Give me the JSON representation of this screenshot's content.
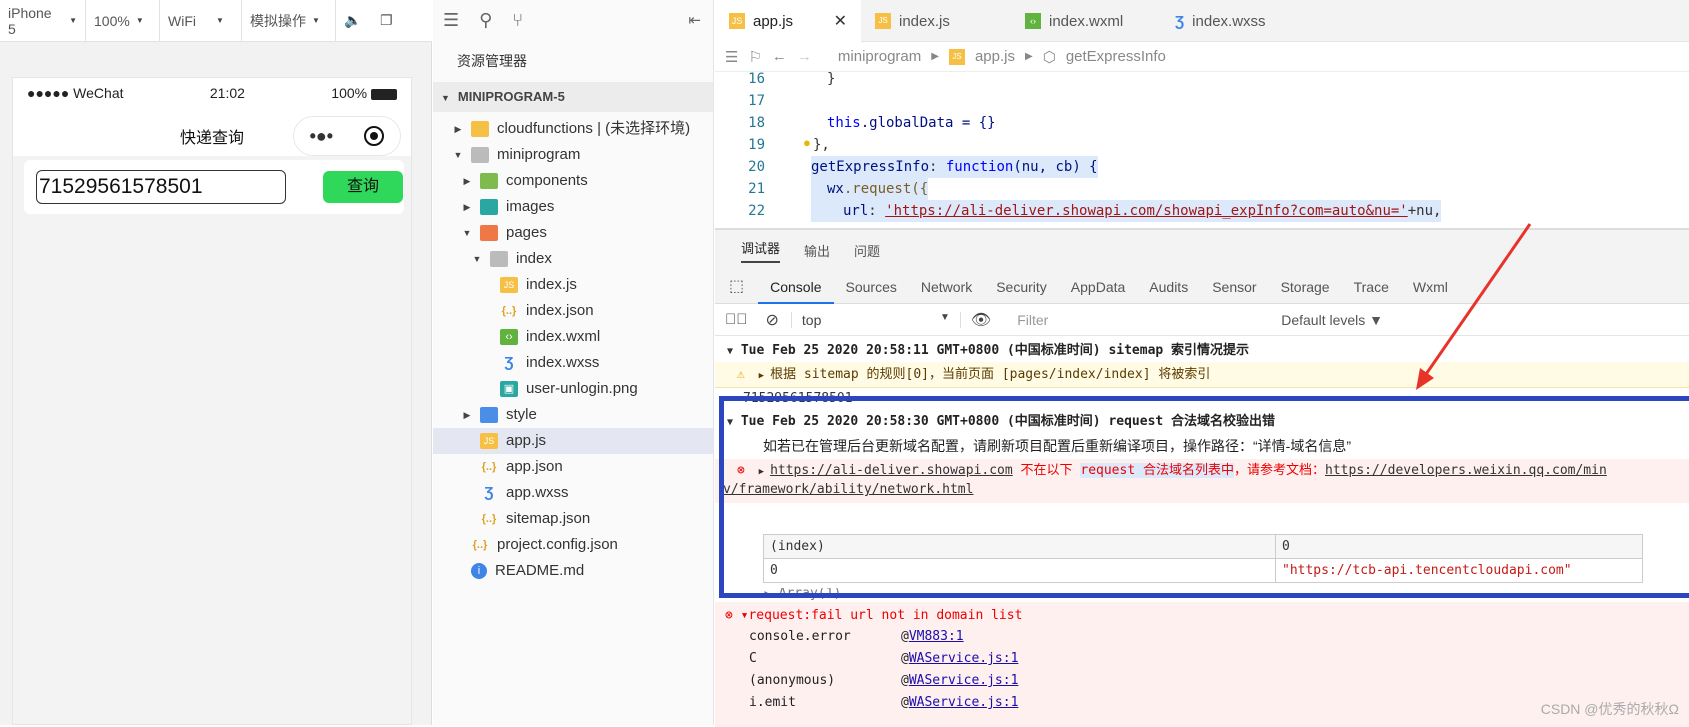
{
  "simulator": {
    "toolbar": {
      "device": "iPhone 5",
      "zoom": "100%",
      "network": "WiFi",
      "operation": "模拟操作"
    },
    "status": {
      "carrier": "●●●●● WeChat",
      "time": "21:02",
      "battery": "100%"
    },
    "page_title": "快递查询",
    "query_input_value": "71529561578501",
    "query_button": "查询"
  },
  "explorer": {
    "title": "资源管理器",
    "project": "MINIPROGRAM-5",
    "items": [
      {
        "label": "cloudfunctions | (未选择环境)",
        "icon": "folder-icon",
        "level": 1
      },
      {
        "label": "miniprogram",
        "icon": "folder-icon",
        "level": 1
      },
      {
        "label": "components",
        "icon": "folder-icon",
        "level": 2
      },
      {
        "label": "images",
        "icon": "folder-icon",
        "level": 2
      },
      {
        "label": "pages",
        "icon": "folder-icon",
        "level": 2
      },
      {
        "label": "index",
        "icon": "folder-icon",
        "level": 3
      },
      {
        "label": "index.js",
        "icon": "js-file-icon",
        "level": 4
      },
      {
        "label": "index.json",
        "icon": "json-file-icon",
        "level": 4
      },
      {
        "label": "index.wxml",
        "icon": "wxml-file-icon",
        "level": 4
      },
      {
        "label": "index.wxss",
        "icon": "wxss-file-icon",
        "level": 4
      },
      {
        "label": "user-unlogin.png",
        "icon": "image-file-icon",
        "level": 4
      },
      {
        "label": "style",
        "icon": "folder-icon",
        "level": 2
      },
      {
        "label": "app.js",
        "icon": "js-file-icon",
        "level": 2
      },
      {
        "label": "app.json",
        "icon": "json-file-icon",
        "level": 2
      },
      {
        "label": "app.wxss",
        "icon": "wxss-file-icon",
        "level": 2
      },
      {
        "label": "sitemap.json",
        "icon": "json-file-icon",
        "level": 2
      },
      {
        "label": "project.config.json",
        "icon": "json-file-icon",
        "level": 1
      },
      {
        "label": "README.md",
        "icon": "info-icon",
        "level": 1
      }
    ]
  },
  "editor": {
    "tabs": [
      "app.js",
      "index.js",
      "index.wxml",
      "index.wxss"
    ],
    "breadcrumb": [
      "miniprogram",
      "app.js",
      "getExpressInfo"
    ],
    "code": {
      "l16_num": "16",
      "l16": "}",
      "l17_num": "17",
      "l18_num": "18",
      "l18a": "this",
      "l18b": ".globalData = {}",
      "l19_num": "19",
      "l19": "},",
      "l20_num": "20",
      "l20a": "getExpressInfo",
      "l20b": ": ",
      "l20c": "function",
      "l20d": "(nu, cb) {",
      "l21_num": "21",
      "l21a": "wx",
      "l21b": ".request({",
      "l22_num": "22",
      "l22a": "url",
      "l22b": ": ",
      "l22c": "'https://ali-deliver.showapi.com/showapi_expInfo?com=auto&nu='",
      "l22d": "+nu,"
    }
  },
  "devtools": {
    "top_tabs": [
      "调试器",
      "输出",
      "问题"
    ],
    "tabs": [
      "Console",
      "Sources",
      "Network",
      "Security",
      "AppData",
      "Audits",
      "Sensor",
      "Storage",
      "Trace",
      "Wxml"
    ],
    "context": "top",
    "filter_placeholder": "Filter",
    "levels": "Default levels ▼",
    "log1_header": "Tue Feb 25 2020 20:58:11 GMT+0800 (中国标准时间) sitemap 索引情况提示",
    "log1_warn": "根据 sitemap 的规则[0]，当前页面 [pages/index/index] 将被索引",
    "log_number": "71529561578501",
    "log2_header": "Tue Feb 25 2020 20:58:30 GMT+0800 (中国标准时间) request 合法域名校验出错",
    "log2_info": "如若已在管理后台更新域名配置，请刷新项目配置后重新编译项目，操作路径：“详情-域名信息”",
    "log2_err_link": "https://ali-deliver.showapi.com",
    "log2_err_text1": " 不在以下 ",
    "log2_err_text2": "request 合法域名列表中",
    "log2_err_text3": "，请参考文档：",
    "log2_err_doc1": "https://developers.weixin.qq.com/min",
    "log2_err_doc2": "v/framework/ability/network.html",
    "table": {
      "h1": "(index)",
      "h2": "0",
      "r1": "0",
      "r2": "\"https://tcb-api.tencentcloudapi.com\""
    },
    "array_label": "▸ Array(1)",
    "err3": "▾request:fail url not in domain list",
    "stack": [
      {
        "fn": "console.error",
        "src": "VM883:1"
      },
      {
        "fn": "C",
        "src": "WAService.js:1"
      },
      {
        "fn": "(anonymous)",
        "src": "WAService.js:1"
      },
      {
        "fn": "i.emit",
        "src": "WAService.js:1"
      }
    ]
  },
  "watermark": "CSDN @优秀的秋秋Ω"
}
